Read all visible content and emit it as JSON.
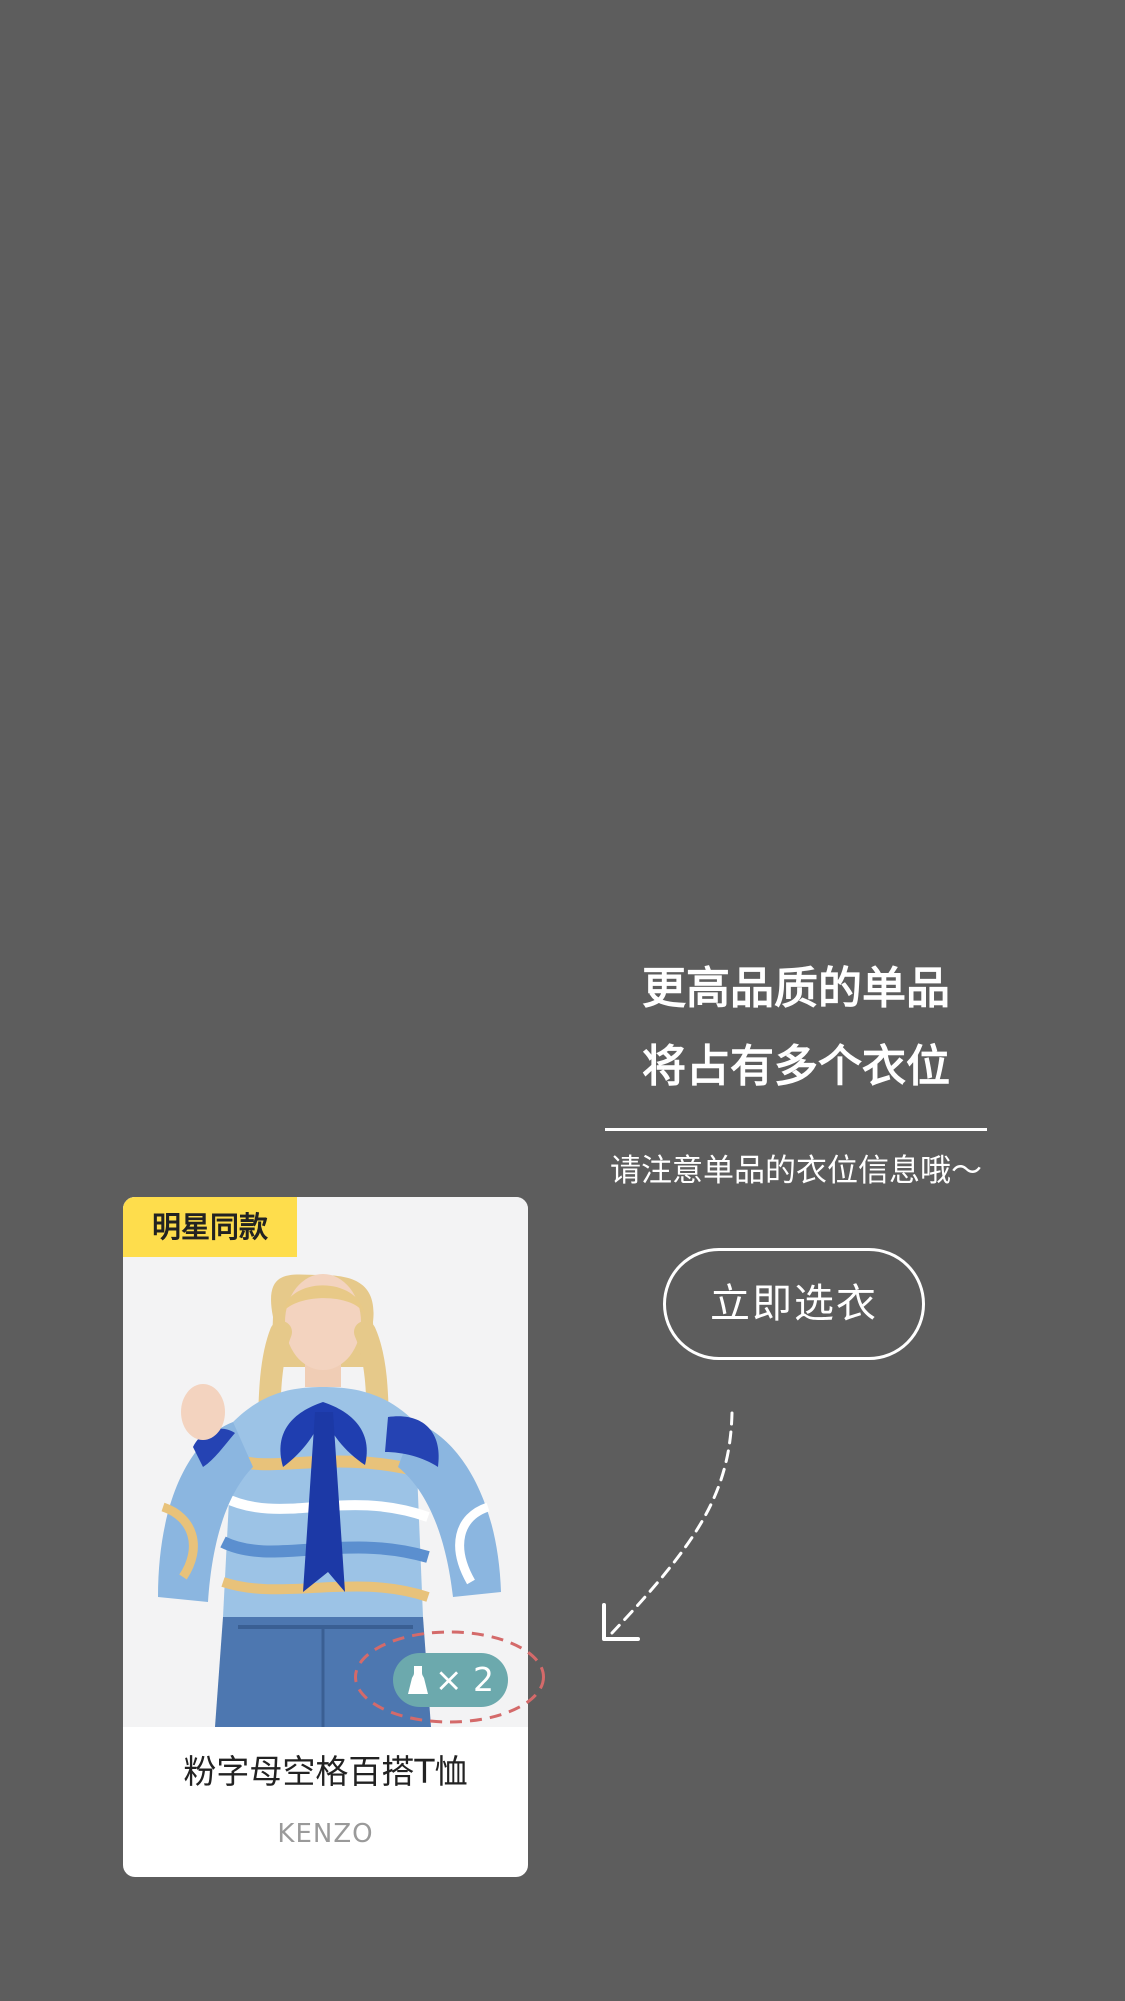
{
  "tip": {
    "headline_line1": "更高品质的单品",
    "headline_line2": "将占有多个衣位",
    "subtext": "请注意单品的衣位信息哦～"
  },
  "cta": {
    "label": "立即选衣"
  },
  "product": {
    "badge": "明星同款",
    "title": "粉字母空格百搭T恤",
    "brand": "KENZO",
    "slot_multiplier": "× 2",
    "slot_icon": "dress-icon"
  },
  "colors": {
    "overlay_background": "#5d5d5d",
    "badge_yellow": "#fedd4c",
    "slot_pill_teal": "#6ca9ad",
    "highlight_dash_red": "#d46a6a"
  }
}
